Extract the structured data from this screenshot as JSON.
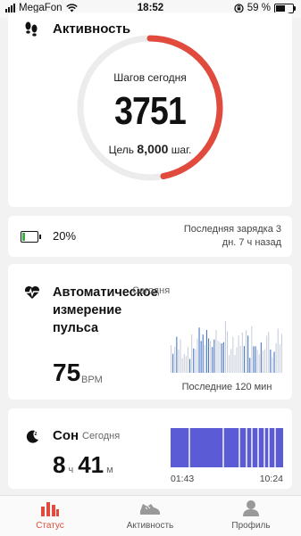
{
  "status_bar": {
    "carrier": "MegaFon",
    "time": "18:52",
    "battery": "59 %",
    "battery_level": 0.59
  },
  "activity": {
    "title": "Активность",
    "label": "Шагов сегодня",
    "steps": "3751",
    "goal_prefix": "Цель",
    "goal_value": "8,000",
    "goal_suffix": "шаг.",
    "progress": 0.469,
    "accent": "#e04b3d"
  },
  "battery_card": {
    "percent": "20%",
    "level": 0.2,
    "last_charge_line1": "Последняя зарядка 3",
    "last_charge_line2": "дн. 7 ч назад",
    "color": "#3cb043"
  },
  "heart": {
    "title": "Автоматическое измерение пульса",
    "today": "Сегодня",
    "value": "75",
    "unit": "BPM",
    "caption": "Последние 120 мин"
  },
  "sleep": {
    "title": "Сон",
    "today": "Сегодня",
    "hours": "8",
    "hours_unit": "ч",
    "minutes": "41",
    "minutes_unit": "м",
    "start": "01:43",
    "end": "10:24",
    "color": "#5b5bd6"
  },
  "tabs": [
    {
      "label": "Статус",
      "icon": "bar-chart-icon",
      "active": true
    },
    {
      "label": "Активность",
      "icon": "shoe-icon",
      "active": false
    },
    {
      "label": "Профиль",
      "icon": "person-icon",
      "active": false
    }
  ]
}
